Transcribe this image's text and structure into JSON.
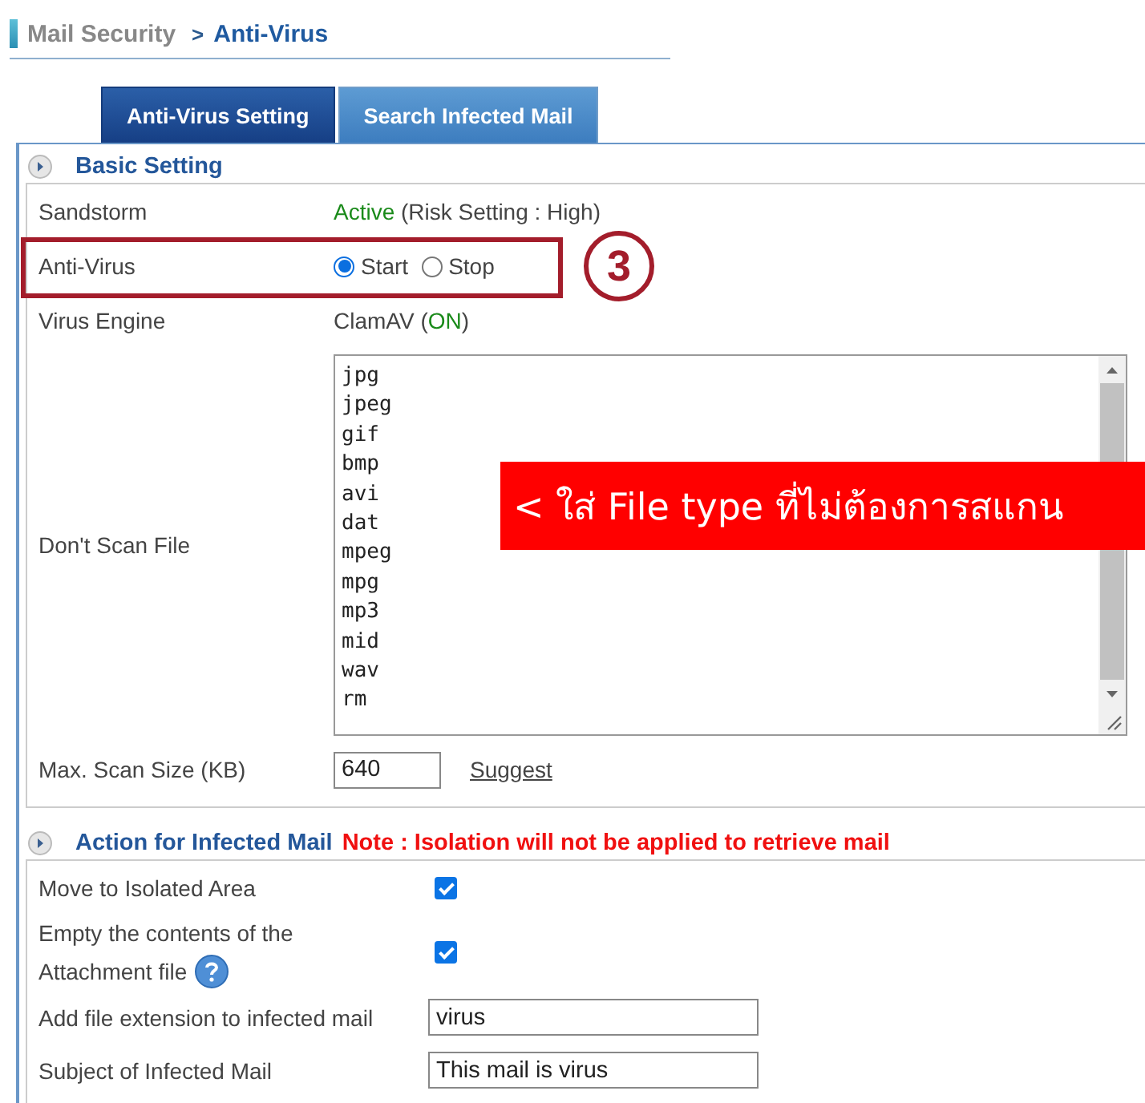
{
  "breadcrumb": {
    "parent": "Mail Security",
    "separator": ">",
    "current": "Anti-Virus"
  },
  "tabs": [
    {
      "label": "Anti-Virus Setting",
      "selected": true
    },
    {
      "label": "Search Infected Mail",
      "selected": false
    }
  ],
  "basic_setting": {
    "title": "Basic Setting",
    "rows": [
      {
        "kind": "status",
        "label": "Sandstorm",
        "status": "Active",
        "detail": "(Risk Setting : High)",
        "highlighted": false
      },
      {
        "kind": "radio",
        "label": "Anti-Virus",
        "highlighted": true,
        "options": [
          {
            "label": "Start",
            "selected": true
          },
          {
            "label": "Stop",
            "selected": false
          }
        ]
      },
      {
        "kind": "engine",
        "label": "Virus Engine",
        "engine": "ClamAV (",
        "status": "ON",
        "after": ")",
        "highlighted": false
      },
      {
        "kind": "list",
        "label": "Don't Scan File",
        "highlighted": false,
        "items": [
          "jpg",
          "jpeg",
          "gif",
          "bmp",
          "avi",
          "dat",
          "mpeg",
          "mpg",
          "mp3",
          "mid",
          "wav",
          "rm"
        ]
      },
      {
        "kind": "input",
        "label": "Max. Scan Size (KB)",
        "value": "640",
        "link": "Suggest",
        "highlighted": false
      }
    ]
  },
  "action_section": {
    "title": "Action for Infected Mail",
    "note": "Note : Isolation will not be applied to retrieve mail",
    "rows": [
      {
        "kind": "checkbox",
        "label": "Move to Isolated Area",
        "checked": true,
        "help": false
      },
      {
        "kind": "checkbox",
        "label": "Empty the contents of the",
        "label_continued": "Attachment file",
        "checked": true,
        "help": true
      },
      {
        "kind": "input",
        "label": "Add file extension to infected mail",
        "value": "virus"
      },
      {
        "kind": "input",
        "label": "Subject of Infected Mail",
        "value": "This mail is virus"
      }
    ]
  },
  "annotations": {
    "step": "3",
    "callout": "< ใส่ File type ที่ไม่ต้องการสแกน"
  }
}
